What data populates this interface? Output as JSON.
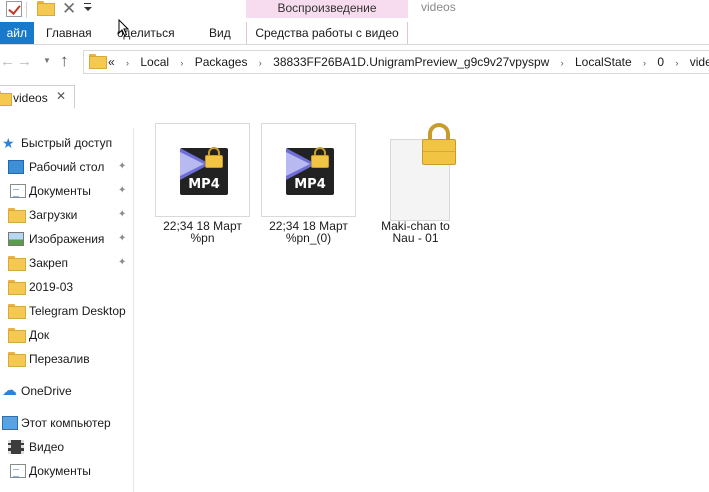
{
  "title_bar": {
    "context_tab": "Воспроизведение",
    "window_title": "videos"
  },
  "ribbon": {
    "tabs": [
      {
        "label": "айл"
      },
      {
        "label": "Главная"
      },
      {
        "label": "оделиться"
      },
      {
        "label": "Вид"
      },
      {
        "label": "Средства работы с видео"
      }
    ]
  },
  "navigation": {
    "back_glyph": "←",
    "forward_glyph": "→",
    "up_glyph": "↑",
    "breadcrumb_prefix": "«",
    "breadcrumb": [
      "Local",
      "Packages",
      "38833FF26BA1D.UnigramPreview_g9c9v27vpyspw",
      "LocalState",
      "0",
      "videos"
    ]
  },
  "tab_bar": {
    "tab_label": "videos",
    "close_glyph": "✕"
  },
  "sidebar": {
    "items": [
      {
        "label": "Быстрый доступ",
        "icon": "star-icon",
        "pinned": false
      },
      {
        "label": "Рабочий стол",
        "icon": "desktop-icon",
        "pinned": true
      },
      {
        "label": "Документы",
        "icon": "documents-icon",
        "pinned": true
      },
      {
        "label": "Загрузки",
        "icon": "downloads-icon",
        "pinned": true
      },
      {
        "label": "Изображения",
        "icon": "pictures-icon",
        "pinned": true
      },
      {
        "label": "Закреп",
        "icon": "folder-icon",
        "pinned": true
      },
      {
        "label": "2019-03",
        "icon": "folder-icon",
        "pinned": false
      },
      {
        "label": "Telegram Desktop",
        "icon": "folder-icon",
        "pinned": false
      },
      {
        "label": "Док",
        "icon": "folder-icon",
        "pinned": false
      },
      {
        "label": "Перезалив",
        "icon": "folder-icon",
        "pinned": false
      },
      {
        "label": "OneDrive",
        "icon": "onedrive-icon",
        "pinned": false
      },
      {
        "label": "Этот компьютер",
        "icon": "computer-icon",
        "pinned": false
      },
      {
        "label": "Видео",
        "icon": "videos-icon",
        "pinned": false
      },
      {
        "label": "Документы",
        "icon": "documents-icon",
        "pinned": false
      }
    ],
    "pin_glyph": "📌"
  },
  "files": [
    {
      "name_line1": "22;34 18 Март",
      "name_line2": "%pn",
      "icon": "mp4-locked-icon",
      "icon_label": "MP4"
    },
    {
      "name_line1": "22;34 18 Март",
      "name_line2": "%pn_(0)",
      "icon": "mp4-locked-icon",
      "icon_label": "MP4"
    },
    {
      "name_line1": "Maki-chan to",
      "name_line2": "Nau - 01",
      "icon": "locked-file-icon",
      "icon_label": ""
    }
  ],
  "colors": {
    "file_tab_accent": "#1979ca",
    "context_tab_bg": "#f7dcef",
    "folder_yellow": "#f3c94f",
    "lock_gold": "#f2c443"
  }
}
